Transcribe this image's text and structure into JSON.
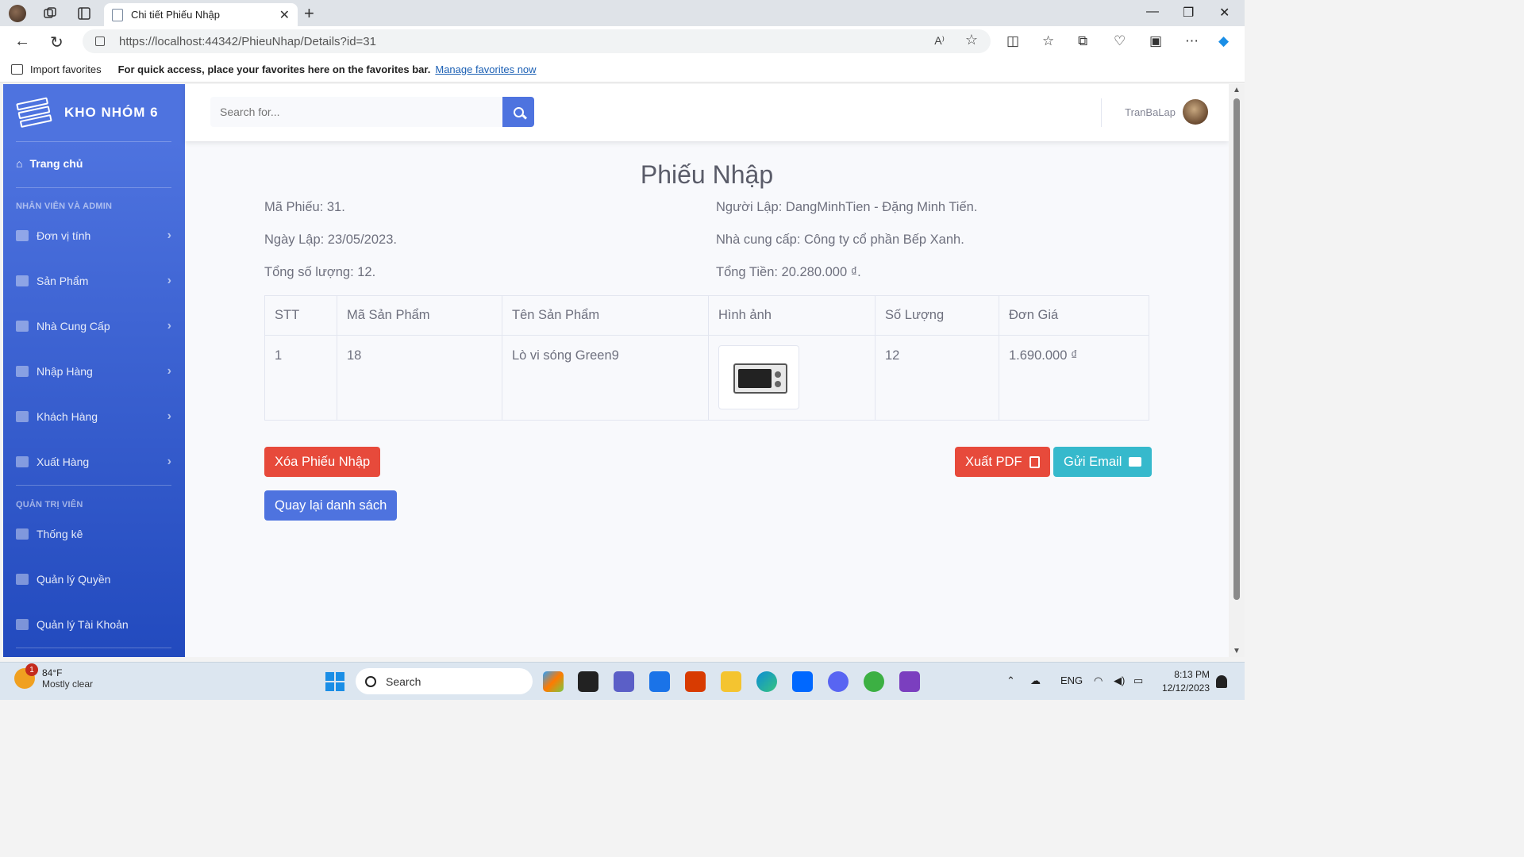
{
  "browser": {
    "tab_title": "Chi tiết Phiếu Nhập",
    "url_host": "https://localhost",
    "url_rest": ":44342/PhieuNhap/Details?id=31",
    "read_aloud": "A⁾",
    "favorites": {
      "import_label": "Import favorites",
      "message": "For quick access, place your favorites here on the favorites bar.",
      "manage_link": "Manage favorites now"
    }
  },
  "sidebar": {
    "brand": "KHO NHÓM 6",
    "home": "Trang chủ",
    "heading_staff": "NHÂN VIÊN VÀ ADMIN",
    "staff_items": [
      {
        "label": "Đơn vị tính",
        "icon": "gear-icon"
      },
      {
        "label": "Sản Phẩm",
        "icon": "dolly-icon"
      },
      {
        "label": "Nhà Cung Cấp",
        "icon": "truck-icon"
      },
      {
        "label": "Nhập Hàng",
        "icon": "file-import-icon"
      },
      {
        "label": "Khách Hàng",
        "icon": "handshake-icon"
      },
      {
        "label": "Xuất Hàng",
        "icon": "file-export-icon"
      }
    ],
    "heading_admin": "QUẢN TRỊ VIÊN",
    "admin_items": [
      {
        "label": "Thống kê",
        "icon": "calculator-icon"
      },
      {
        "label": "Quản lý Quyền",
        "icon": "gavel-icon"
      },
      {
        "label": "Quản lý Tài Khoản",
        "icon": "user-icon"
      }
    ]
  },
  "topbar": {
    "search_placeholder": "Search for...",
    "username": "TranBaLap"
  },
  "receipt": {
    "title": "Phiếu Nhập",
    "ma_phieu": "Mã Phiếu: 31.",
    "ngay_lap": "Ngày Lập: 23/05/2023.",
    "tong_so_luong": "Tổng số lượng: 12.",
    "nguoi_lap": "Người Lập: DangMinhTien - Đặng Minh Tiến.",
    "nha_cung_cap": "Nhà cung cấp: Công ty cổ phần Bếp Xanh.",
    "tong_tien": "Tổng Tiền: 20.280.000 ₫."
  },
  "table": {
    "headers": [
      "STT",
      "Mã Sản Phẩm",
      "Tên Sản Phẩm",
      "Hình ảnh",
      "Số Lượng",
      "Đơn Giá"
    ],
    "rows": [
      {
        "stt": "1",
        "ma": "18",
        "ten": "Lò vi sóng Green9",
        "so_luong": "12",
        "don_gia": "1.690.000 ₫"
      }
    ]
  },
  "actions": {
    "delete": "Xóa Phiếu Nhập",
    "back": "Quay lại danh sách",
    "pdf": "Xuất PDF",
    "email": "Gửi Email"
  },
  "taskbar": {
    "weather_badge": "1",
    "temperature": "84°F",
    "weather_desc": "Mostly clear",
    "search_label": "Search",
    "language": "ENG",
    "time": "8:13 PM",
    "date": "12/12/2023"
  },
  "colors": {
    "primary": "#4e73df",
    "danger": "#e74a3b",
    "info": "#36b9cc"
  }
}
